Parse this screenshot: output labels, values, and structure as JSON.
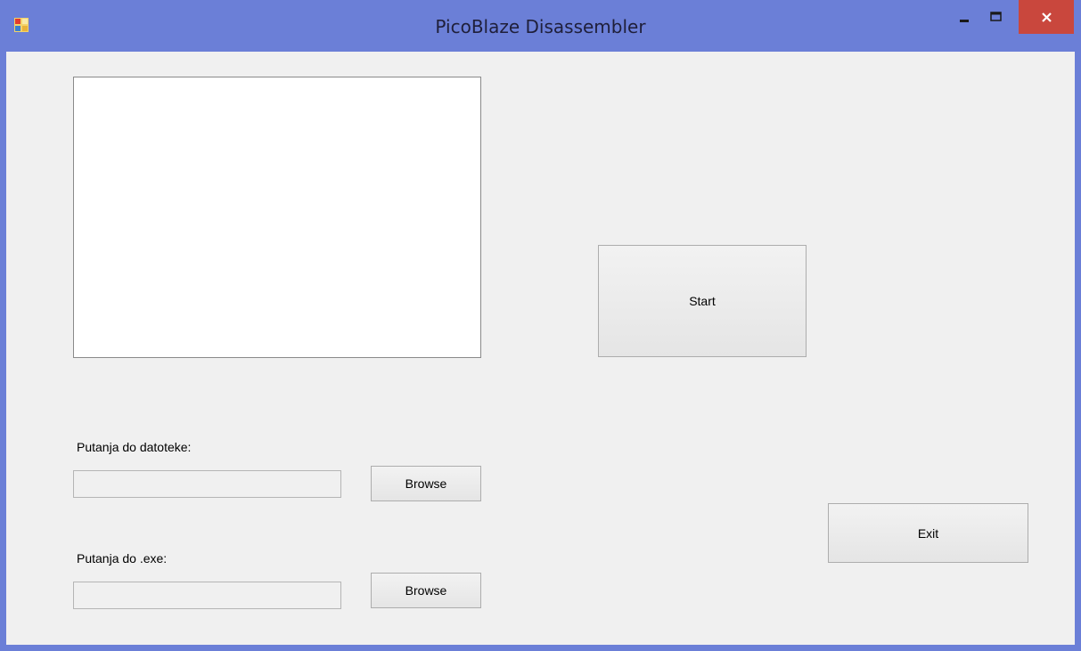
{
  "window": {
    "title": "PicoBlaze Disassembler",
    "icons": {
      "app": "application-icon",
      "minimize": "minimize-icon",
      "maximize": "maximize-icon",
      "close": "close-icon"
    },
    "colors": {
      "titlebar": "#6b7fd7",
      "close_button": "#c9473d",
      "client": "#f0f0f0"
    }
  },
  "main": {
    "output_list_items": [],
    "start_label": "Start",
    "exit_label": "Exit",
    "file_path": {
      "label": "Putanja do datoteke:",
      "value": "",
      "browse_label": "Browse"
    },
    "exe_path": {
      "label": "Putanja do .exe:",
      "value": "",
      "browse_label": "Browse"
    }
  }
}
